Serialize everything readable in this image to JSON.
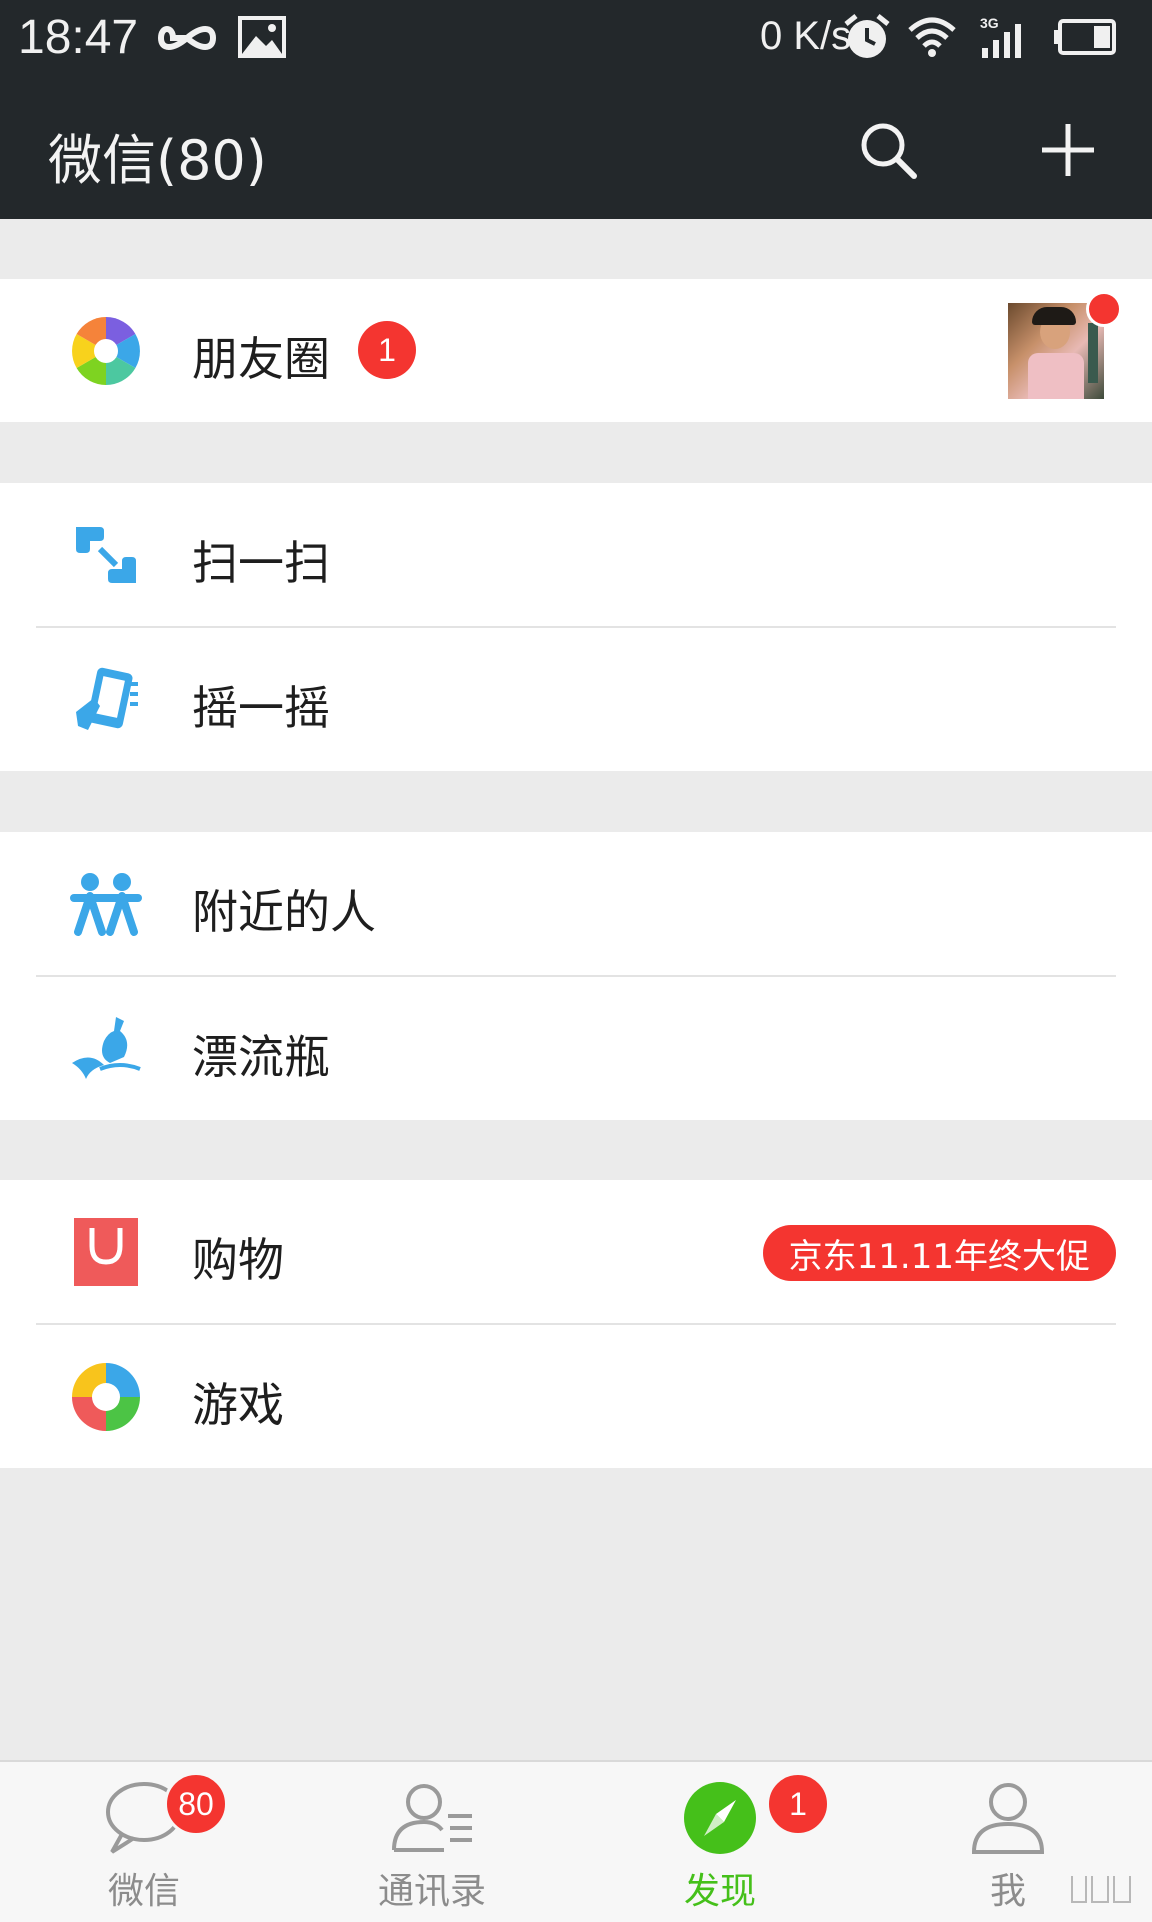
{
  "status_bar": {
    "time": "18:47",
    "net_speed": "0 K/s"
  },
  "header": {
    "title": "微信(80)",
    "search_icon": "search-icon",
    "add_icon": "plus-icon"
  },
  "groups": [
    {
      "items": [
        {
          "label": "朋友圈",
          "icon": "moments-aperture-icon",
          "badge": "1",
          "has_avatar_preview": true
        }
      ]
    },
    {
      "items": [
        {
          "label": "扫一扫",
          "icon": "scan-icon"
        },
        {
          "label": "摇一摇",
          "icon": "shake-icon"
        }
      ]
    },
    {
      "items": [
        {
          "label": "附近的人",
          "icon": "people-nearby-icon"
        },
        {
          "label": "漂流瓶",
          "icon": "drift-bottle-icon"
        }
      ]
    },
    {
      "items": [
        {
          "label": "购物",
          "icon": "shopping-bag-icon",
          "promo": "京东11.11年终大促"
        },
        {
          "label": "游戏",
          "icon": "games-icon"
        }
      ]
    }
  ],
  "tabs": [
    {
      "label": "微信",
      "icon": "chat-bubble-icon",
      "badge": "80",
      "active": false
    },
    {
      "label": "通讯录",
      "icon": "contacts-icon",
      "active": false
    },
    {
      "label": "发现",
      "icon": "compass-icon",
      "badge": "1",
      "active": true
    },
    {
      "label": "我",
      "icon": "person-icon",
      "active": false
    }
  ],
  "colors": {
    "header_bg": "#23282b",
    "badge": "#f43530",
    "accent_green": "#45c01a",
    "icon_blue": "#3ba7e8"
  }
}
